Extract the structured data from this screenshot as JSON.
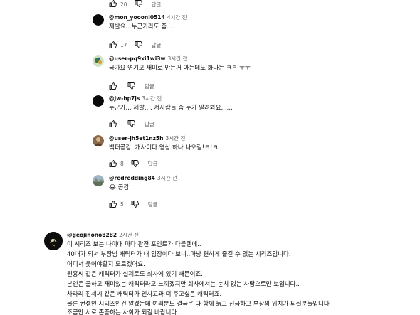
{
  "top_actions": {
    "like_count": "20",
    "reply_label": "답글"
  },
  "replies": [
    {
      "author": "@mon_yoooni0514",
      "time": "4시간 전",
      "text": "제발요...누군가라도 좀....",
      "likes": "17",
      "reply_label": "답글",
      "avatar": "black-circle"
    },
    {
      "author": "@user-pq9xi1wi3w",
      "time": "3시간 전",
      "text": "궁가요 연기고 재미로 만든거 아는데도 화나는 ㅋㅋ ㅜㅜ",
      "likes": "",
      "reply_label": "답글",
      "avatar": "colorful"
    },
    {
      "author": "@Jw-hp7js",
      "time": "3시간 전",
      "text": "누군가... 제발.... 저사람들 좀 누가 말려봐요......",
      "likes": "",
      "reply_label": "답글",
      "avatar": "black-circle"
    },
    {
      "author": "@user-jh5et1nz5h",
      "time": "3시간 전",
      "text": "백퍼공감. 개사이다 영상 하나 나오길!ㅋ!ㅋ",
      "likes": "8",
      "reply_label": "답글",
      "avatar": "brown"
    },
    {
      "author": "@redredding84",
      "time": "3시간 전",
      "text": "😂 공감",
      "likes": "5",
      "reply_label": "답글",
      "avatar": "landscape"
    }
  ],
  "main_comment": {
    "author": "@geojinono8282",
    "time": "2시간 전",
    "lines": [
      "이 시리즈 보는 나이대 마다 관전 포인트가 다를텐데..",
      "40대가 되서 부장님 캐릭터가 내 입장이다 보니..마냥 편하게 즐길 수 없는 시리즈입니다.",
      "어디서 웃어야할지 모르겠어요.",
      "원흉씨 같은 캐릭터가 실제로도 회사에 있기 때문이죠.",
      "본인은 쿨하고 재미있는 캐릭터라고 느끼겠지만 회사에서는 눈치 없는 사람으로만 보입니다..",
      "차라리 진세씨 같은 캐릭터가 인사고과 더 주고싶은 캐릭터죠.",
      "물론 컨셉인 시리즈인건 알겠는데 여러분도 결국은 다 함께 늙고 진급하고 부장의 위치가 되실분들입니다",
      "조금만 서로 존중하는 사회가 되길 바랍니다.."
    ]
  },
  "icons": {
    "like": "thumbs-up-icon",
    "dislike": "thumbs-down-icon"
  }
}
